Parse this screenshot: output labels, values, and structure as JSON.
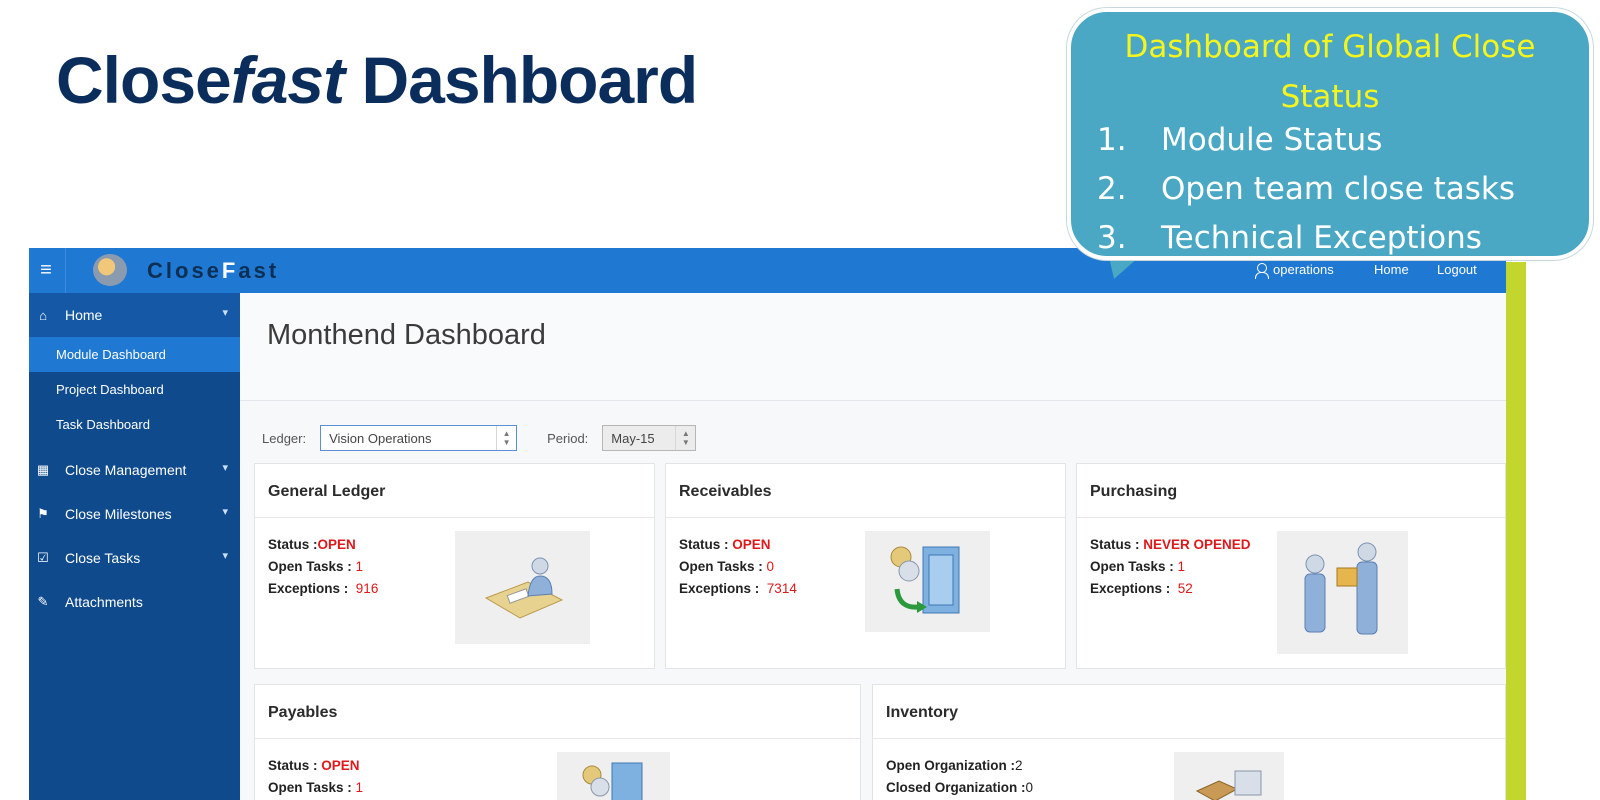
{
  "slide": {
    "title_part1": "Close",
    "title_em": "fast",
    "title_part2": " Dashboard"
  },
  "callout": {
    "title": "Dashboard of Global Close Status",
    "items": [
      {
        "num": "1.",
        "text": "Module Status"
      },
      {
        "num": "2.",
        "text": "Open team close tasks"
      },
      {
        "num": "3.",
        "text": "Technical Exceptions"
      }
    ]
  },
  "topbar": {
    "logo_part1": "Close",
    "logo_highlight": "F",
    "logo_part2": "ast",
    "user": "operations",
    "home": "Home",
    "logout": "Logout"
  },
  "sidebar": {
    "home": "Home",
    "subitems": [
      "Module Dashboard",
      "Project Dashboard",
      "Task Dashboard"
    ],
    "items": [
      "Close Management",
      "Close Milestones",
      "Close Tasks",
      "Attachments"
    ]
  },
  "page": {
    "title": "Monthend Dashboard",
    "ledger_label": "Ledger:",
    "ledger_value": "Vision Operations",
    "period_label": "Period:",
    "period_value": "May-15"
  },
  "cards": {
    "gl": {
      "title": "General Ledger",
      "status_label": "Status :",
      "status": "OPEN",
      "open_label": "Open Tasks :",
      "open": "1",
      "exc_label": "Exceptions :",
      "exc": "916"
    },
    "ar": {
      "title": "Receivables",
      "status_label": "Status :",
      "status": "OPEN",
      "open_label": "Open Tasks :",
      "open": "0",
      "exc_label": "Exceptions :",
      "exc": "7314"
    },
    "po": {
      "title": "Purchasing",
      "status_label": "Status :",
      "status": "NEVER OPENED",
      "open_label": "Open Tasks :",
      "open": "1",
      "exc_label": "Exceptions :",
      "exc": "52"
    },
    "ap": {
      "title": "Payables",
      "status_label": "Status :",
      "status": "OPEN",
      "open_label": "Open Tasks :",
      "open": "1"
    },
    "inv": {
      "title": "Inventory",
      "open_org_label": "Open Organization :",
      "open_org": "2",
      "closed_org_label": "Closed Organization :",
      "closed_org": "0"
    }
  },
  "colors": {
    "topbar": "#1f78d1",
    "sidebar": "#0f4a8c",
    "status_red": "#e0181b",
    "callout": "#4aa8c4",
    "callout_title": "#f4f41f",
    "accent_bar": "#c2d62e"
  }
}
